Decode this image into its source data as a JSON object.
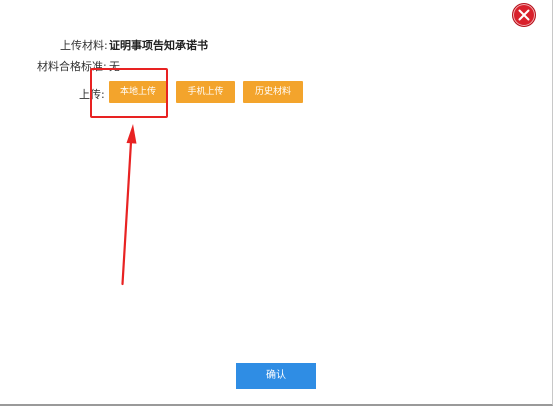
{
  "dialog": {
    "close_icon": "close-icon",
    "material_label": "上传材料:",
    "material_value": "证明事项告知承诺书",
    "standard_label": "材料合格标准:",
    "standard_value": "无",
    "upload_label": "上传:",
    "buttons": {
      "local_upload": "本地上传",
      "phone_upload": "手机上传",
      "history_material": "历史材料"
    },
    "confirm_label": "确认"
  },
  "colors": {
    "accent_orange": "#f3a42c",
    "confirm_blue": "#2f8de4",
    "close_red": "#d9202b",
    "annotation_red": "#e82222"
  }
}
